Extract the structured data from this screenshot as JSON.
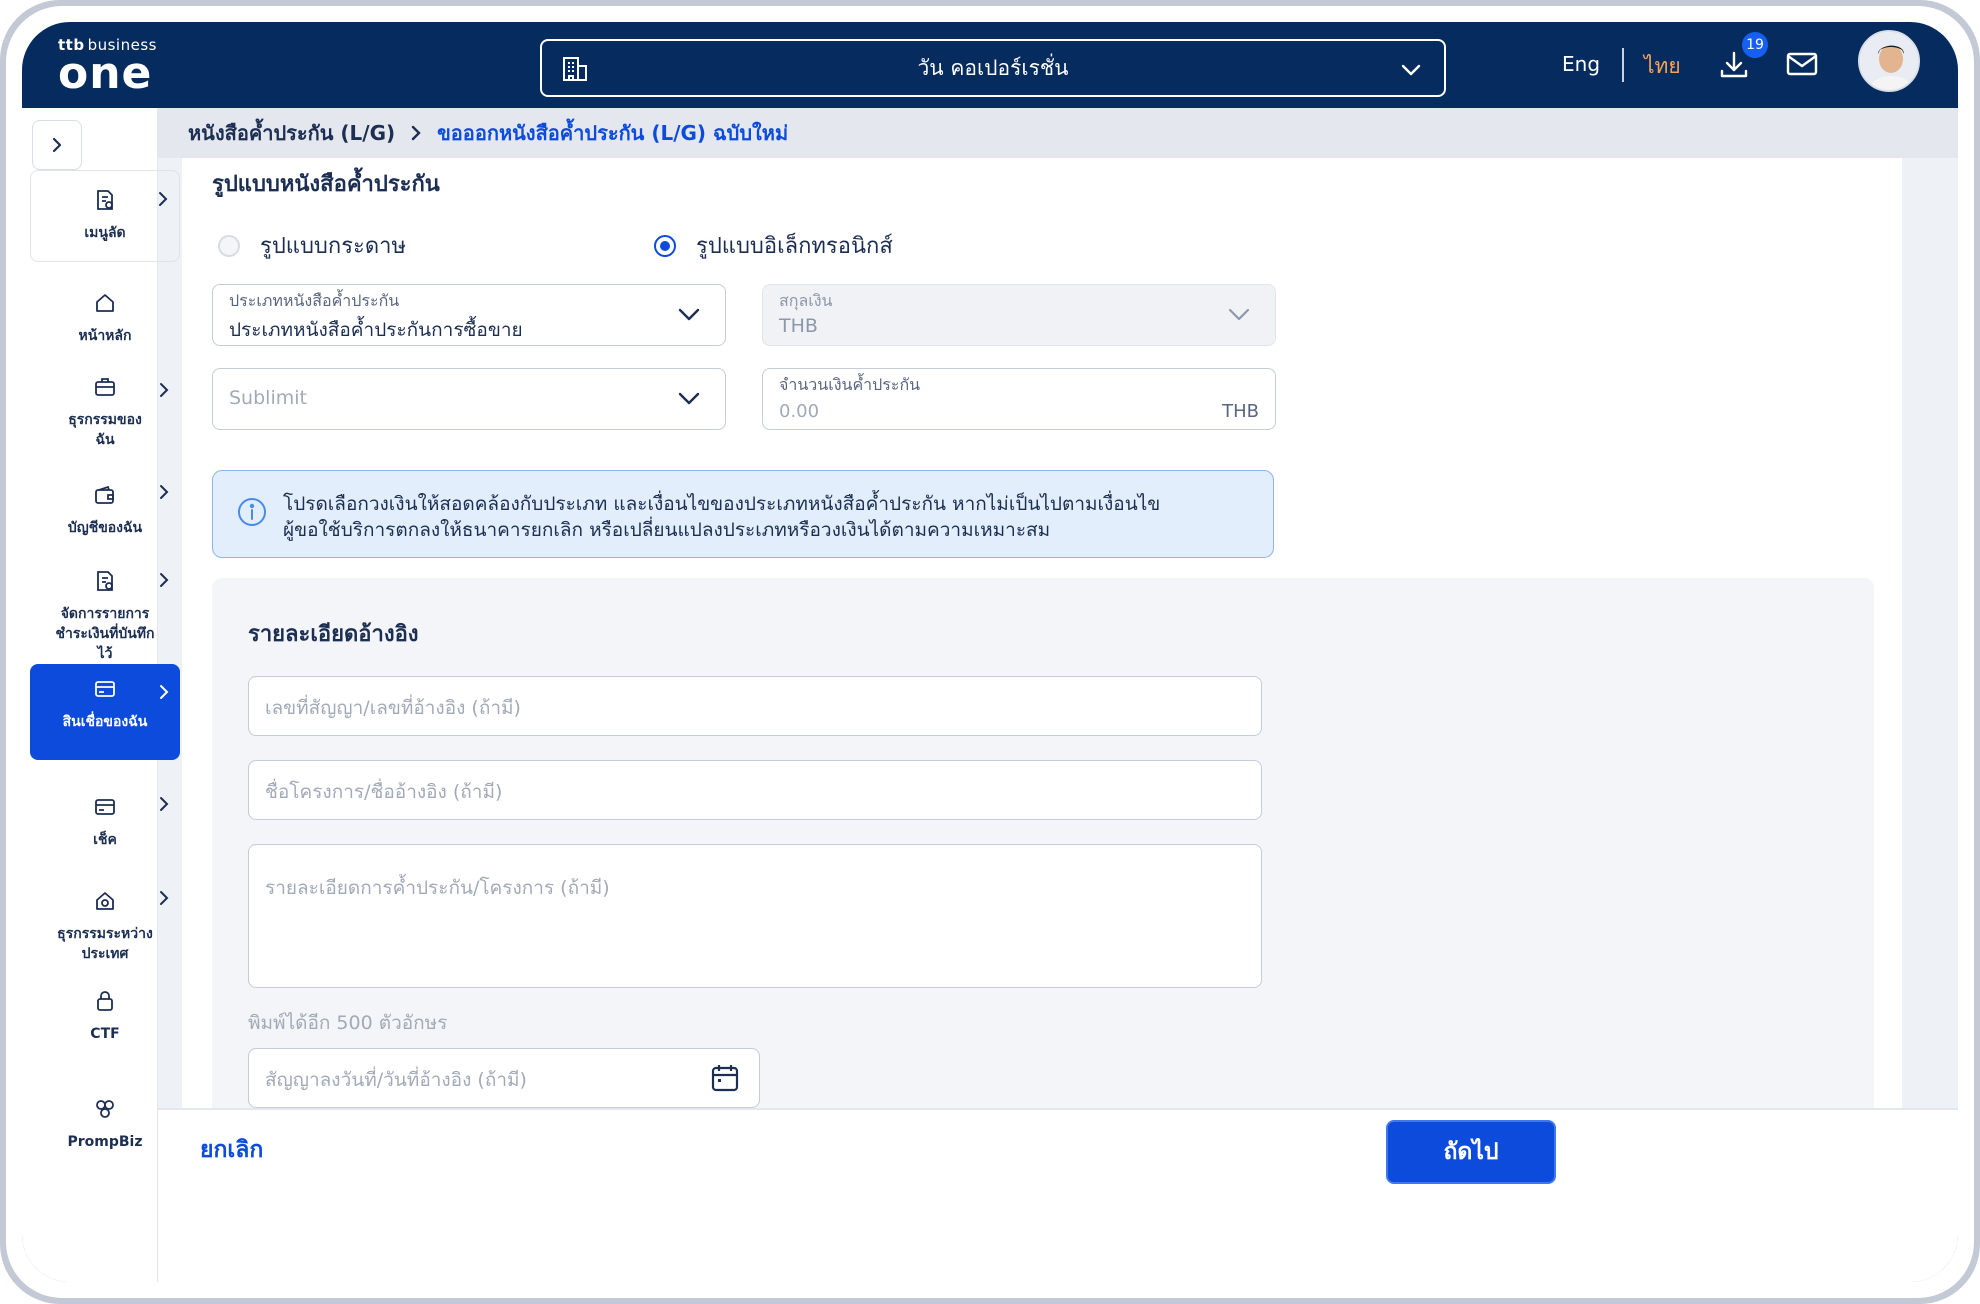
{
  "header": {
    "logo_small": "ttb",
    "logo_business": "business",
    "logo_main": "one",
    "company_name": "วัน คอเปอร์เรชั่น",
    "lang_en": "Eng",
    "lang_th": "ไทย",
    "download_count": "19"
  },
  "sidebar": {
    "items": [
      {
        "label": "เมนูลัด"
      },
      {
        "label": "หน้าหลัก"
      },
      {
        "label": "ธุรกรรมของฉัน"
      },
      {
        "label": "บัญชีของฉัน"
      },
      {
        "label": "จัดการรายการชำระเงินที่บันทึกไว้"
      },
      {
        "label": "สินเชื่อของฉัน"
      },
      {
        "label": "เช็ค"
      },
      {
        "label": "ธุรกรรมระหว่างประเทศ"
      },
      {
        "label": "CTF"
      },
      {
        "label": "PrompBiz"
      }
    ]
  },
  "breadcrumb": {
    "root": "หนังสือค้ำประกัน (L/G)",
    "current": "ขอออกหนังสือค้ำประกัน (L/G) ฉบับใหม่"
  },
  "form": {
    "section_title": "รูปแบบหนังสือค้ำประกัน",
    "radio_paper": "รูปแบบกระดาษ",
    "radio_electronic": "รูปแบบอิเล็กทรอนิกส์",
    "lg_type_label": "ประเภทหนังสือค้ำประกัน",
    "lg_type_value": "ประเภทหนังสือค้ำประกันการซื้อขาย",
    "currency_label": "สกุลเงิน",
    "currency_value": "THB",
    "sublimit_placeholder": "Sublimit",
    "amount_label": "จำนวนเงินค้ำประกัน",
    "amount_placeholder": "0.00",
    "amount_suffix": "THB",
    "info_line1": "โปรดเลือกวงเงินให้สอดคล้องกับประเภท และเงื่อนไขของประเภทหนังสือค้ำประกัน หากไม่เป็นไปตามเงื่อนไข",
    "info_line2": "ผู้ขอใช้บริการตกลงให้ธนาคารยกเลิก หรือเปลี่ยนแปลงประเภทหรือวงเงินได้ตามความเหมาะสม"
  },
  "reference": {
    "title": "รายละเอียดอ้างอิง",
    "contract_no_placeholder": "เลขที่สัญญา/เลขที่อ้างอิง (ถ้ามี)",
    "project_name_placeholder": "ชื่อโครงการ/ชื่ออ้างอิง (ถ้ามี)",
    "details_placeholder": "รายละเอียดการค้ำประกัน/โครงการ (ถ้ามี)",
    "char_counter": "พิมพ์ได้อีก 500 ตัวอักษร",
    "date_placeholder": "สัญญาลงวันที่/วันที่อ้างอิง (ถ้ามี)"
  },
  "footer": {
    "cancel_label": "ยกเลิก",
    "next_label": "ถัดไป"
  },
  "colors": {
    "header_bg": "#062b5e",
    "accent": "#0c4bdc",
    "lang_active": "#f5a35c"
  }
}
